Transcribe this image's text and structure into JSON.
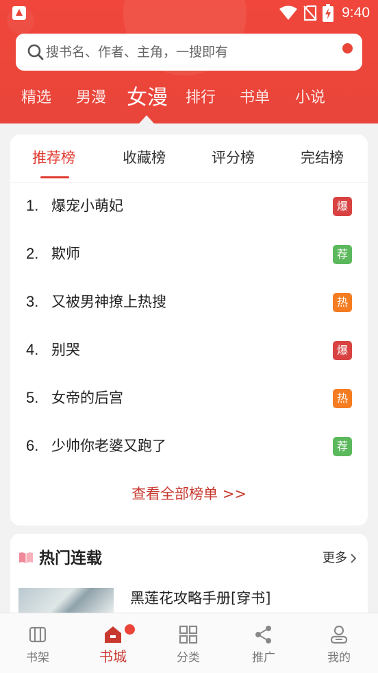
{
  "status_bar": {
    "time": "9:40"
  },
  "search": {
    "placeholder": "搜书名、作者、主角，一搜即有"
  },
  "top_tabs": [
    "精选",
    "男漫",
    "女漫",
    "排行",
    "书单",
    "小说"
  ],
  "top_tabs_active": "女漫",
  "rank_tabs": [
    "推荐榜",
    "收藏榜",
    "评分榜",
    "完结榜"
  ],
  "rank_tabs_active": "推荐榜",
  "rank_list": [
    {
      "num": "1.",
      "title": "爆宠小萌妃",
      "badge": "爆",
      "badge_color": "#d94242"
    },
    {
      "num": "2.",
      "title": "欺师",
      "badge": "荐",
      "badge_color": "#5cb85c"
    },
    {
      "num": "3.",
      "title": "又被男神撩上热搜",
      "badge": "热",
      "badge_color": "#f57c20"
    },
    {
      "num": "4.",
      "title": "别哭",
      "badge": "爆",
      "badge_color": "#d94242"
    },
    {
      "num": "5.",
      "title": "女帝的后宫",
      "badge": "热",
      "badge_color": "#f57c20"
    },
    {
      "num": "6.",
      "title": "少帅你老婆又跑了",
      "badge": "荐",
      "badge_color": "#5cb85c"
    }
  ],
  "view_all": "查看全部榜单 >>",
  "hot": {
    "title": "热门连载",
    "more": "更多",
    "books": [
      {
        "title": "黑莲花攻略手册[穿书]"
      }
    ]
  },
  "bottom_nav": [
    {
      "label": "书架",
      "icon": "bookshelf-icon"
    },
    {
      "label": "书城",
      "icon": "bookstore-icon"
    },
    {
      "label": "分类",
      "icon": "category-icon"
    },
    {
      "label": "推广",
      "icon": "share-icon"
    },
    {
      "label": "我的",
      "icon": "profile-icon"
    }
  ],
  "bottom_nav_active": "书城",
  "colors": {
    "brand": "#ea4538",
    "accent_text": "#c8392f"
  }
}
